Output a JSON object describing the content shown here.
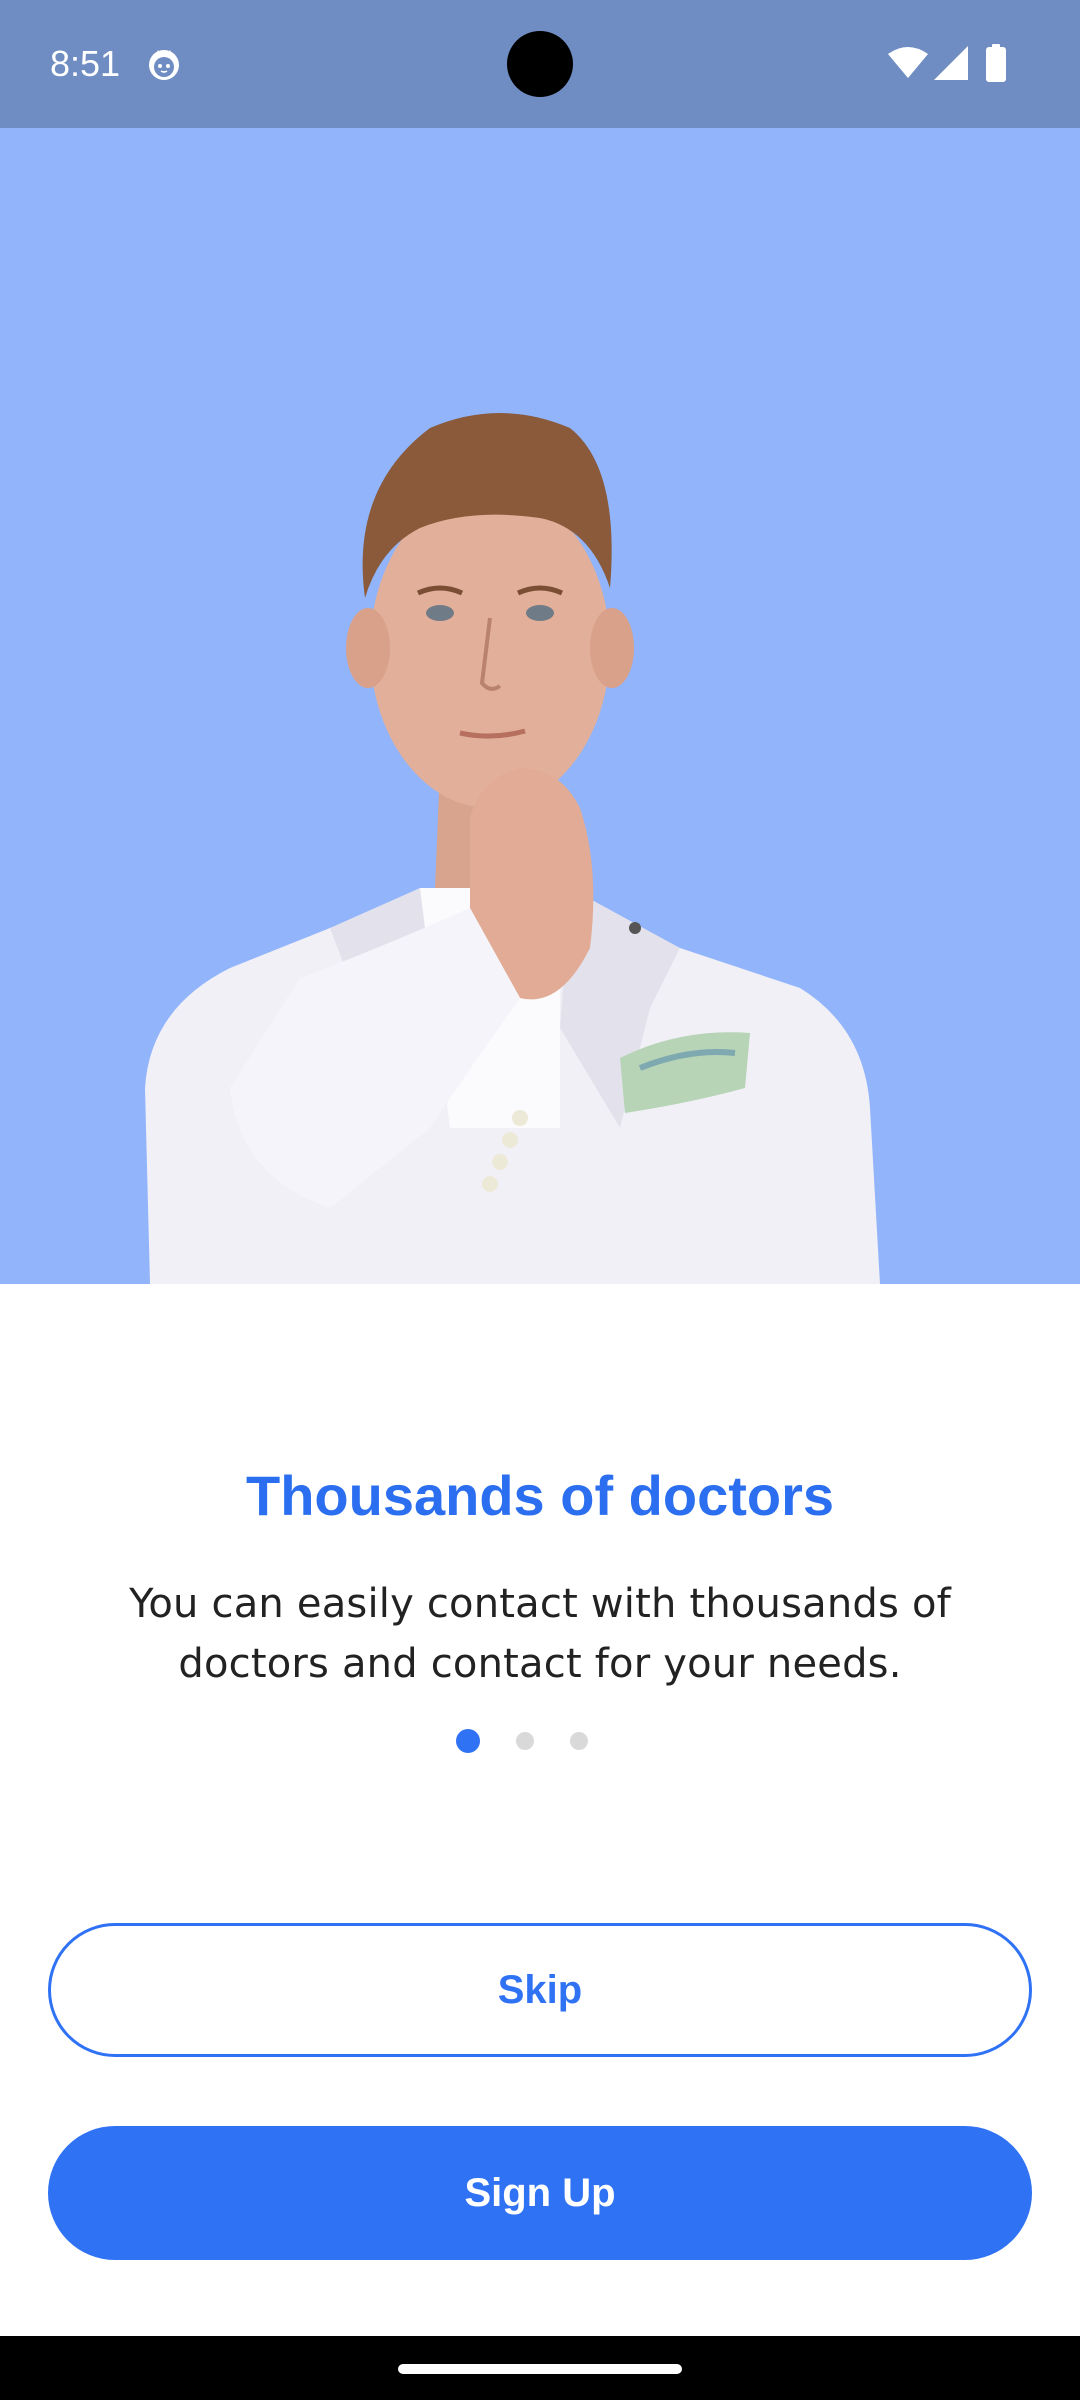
{
  "status_bar": {
    "time": "8:51",
    "app_icon": "cat-face-icon",
    "wifi_icon": "wifi-icon",
    "signal_icon": "cell-signal-icon",
    "battery_icon": "battery-icon",
    "background_color": "#6f8dc2"
  },
  "hero": {
    "image": "doctor-portrait-image",
    "background_color": "#91b4fb"
  },
  "onboarding": {
    "title": "Thousands of doctors",
    "description": "You can easily contact with thousands of doctors and contact for your needs.",
    "page_count": 3,
    "active_page": 1
  },
  "actions": {
    "skip_label": "Skip",
    "signup_label": "Sign Up"
  },
  "colors": {
    "primary": "#2f72f4",
    "title": "#2b6ff0",
    "text": "#222222",
    "inactive_dot": "#d9d9d9"
  }
}
